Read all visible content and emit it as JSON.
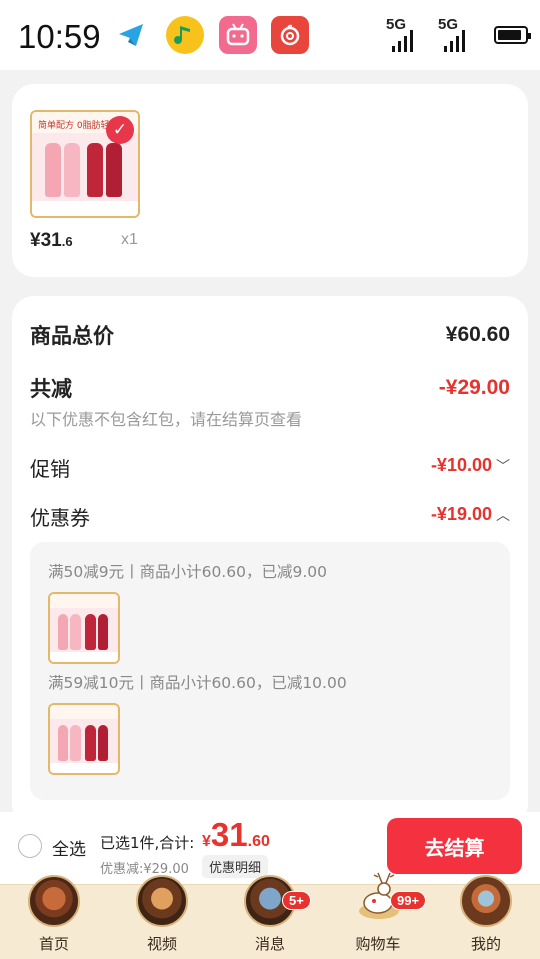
{
  "status_bar": {
    "time": "10:59",
    "signal_1": "5G",
    "signal_2": "5G",
    "battery_level": 0.9,
    "apps": [
      {
        "name": "telegram-icon",
        "color": "#2aa3e6"
      },
      {
        "name": "qq-music-icon",
        "color": "#f7c21c"
      },
      {
        "name": "bilibili-icon",
        "color": "#f26b8f"
      },
      {
        "name": "netease-music-icon",
        "color": "#e8453c"
      }
    ]
  },
  "cart_item": {
    "thumb_header": "简单配方 0脂肪轻",
    "price_int": "¥31",
    "price_dec": ".6",
    "quantity": "x1"
  },
  "summary": {
    "total_label": "商品总价",
    "total_value": "¥60.60",
    "reduce_label": "共减",
    "reduce_value": "-¥29.00",
    "hint": "以下优惠不包含红包，请在结算页查看",
    "promo_label": "促销",
    "promo_value": "-¥10.00",
    "coupon_label": "优惠券",
    "coupon_value": "-¥19.00",
    "coupons": [
      {
        "text": "满50减9元丨商品小计60.60，已减9.00"
      },
      {
        "text": "满59减10元丨商品小计60.60，已减10.00"
      }
    ]
  },
  "checkout_bar": {
    "select_all": "全选",
    "selected_text": "已选1件,合计:",
    "total_currency": "¥",
    "total_int": "31",
    "total_dec": ".60",
    "discount_text": "优惠减:¥29.00",
    "detail_button": "优惠明细",
    "checkout_button": "去结算"
  },
  "tabbar": {
    "tabs": [
      {
        "label": "首页"
      },
      {
        "label": "视频"
      },
      {
        "label": "消息",
        "badge": "5+"
      },
      {
        "label": "购物车",
        "badge": "99+"
      },
      {
        "label": "我的"
      }
    ]
  },
  "colors": {
    "accent_red": "#e8322d",
    "checkout_red": "#f4323f",
    "tabbar_bg": "#f6ead2"
  }
}
